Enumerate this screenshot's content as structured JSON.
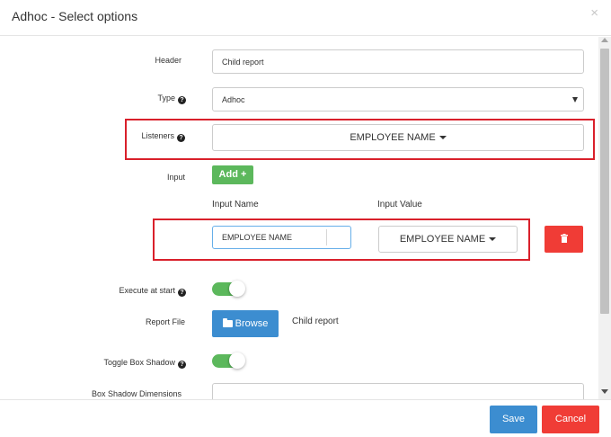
{
  "modal": {
    "title": "Adhoc - Select options",
    "close_glyph": "×"
  },
  "form": {
    "header": {
      "label": "Header",
      "value": "Child report"
    },
    "type": {
      "label": "Type",
      "value": "Adhoc",
      "help": "?"
    },
    "listeners": {
      "label": "Listeners",
      "value": "EMPLOYEE NAME",
      "help": "?"
    },
    "input": {
      "label": "Input",
      "add_label": "Add",
      "add_icon": "+",
      "name_header": "Input Name",
      "value_header": "Input Value",
      "name_value": "EMPLOYEE NAME",
      "value_value": "EMPLOYEE NAME"
    },
    "execute_at_start": {
      "label": "Execute at start",
      "help": "?",
      "enabled": true
    },
    "report_file": {
      "label": "Report File",
      "browse_label": "Browse",
      "file_name": "Child report"
    },
    "toggle_box_shadow": {
      "label": "Toggle Box Shadow",
      "help": "?",
      "enabled": true
    },
    "box_shadow_dimensions": {
      "label": "Box Shadow Dimensions",
      "value": ""
    }
  },
  "footer": {
    "save_label": "Save",
    "cancel_label": "Cancel"
  },
  "colors": {
    "highlight": "#d9202b",
    "add_button": "#5cb85c",
    "primary": "#3c8dd0",
    "danger": "#f03c36",
    "toggle_on": "#5cb85c"
  }
}
